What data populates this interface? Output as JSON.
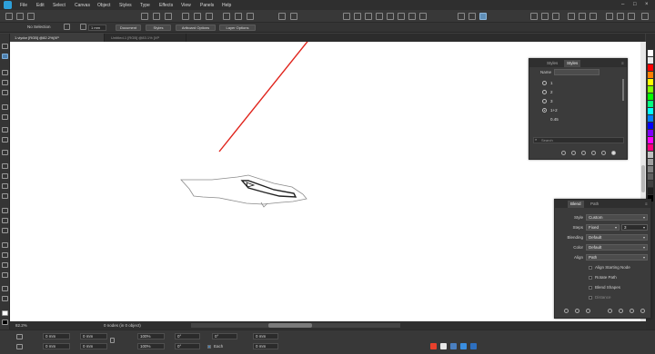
{
  "menu": {
    "items": [
      "File",
      "Edit",
      "Select",
      "Canvas",
      "Object",
      "Styles",
      "Type",
      "Effects",
      "View",
      "Panels",
      "Help"
    ]
  },
  "contextbar": {
    "selection": "No Selection",
    "stroke_value": "1 mm",
    "buttons": [
      "Document",
      "Styles",
      "Artboard Options",
      "Layer Options"
    ]
  },
  "doc_tabs": [
    {
      "label": "1.viydor [RGB] @82.2%[XP",
      "active": true
    },
    {
      "label": "Untitled-1 [RGB] @83.1% [XP",
      "active": false
    }
  ],
  "styles_panel": {
    "tabs": [
      "Styles",
      "Styles"
    ],
    "name_label": "Name",
    "items": [
      "1",
      "2",
      "3",
      "1+2",
      "0.45"
    ],
    "search_placeholder": "Search"
  },
  "blend_panel": {
    "tabs": [
      "Blend",
      "Path"
    ],
    "rows": [
      {
        "label": "Style",
        "value": "Custom"
      },
      {
        "label": "Steps",
        "value": "Fixed",
        "number": "3"
      },
      {
        "label": "Blending",
        "value": "Default"
      },
      {
        "label": "Color",
        "value": "Default"
      },
      {
        "label": "Align",
        "value": "Path"
      }
    ],
    "checks": [
      "Align Starting Node",
      "Rotate Path",
      "Blend Shapes",
      "Distance"
    ]
  },
  "statusbar": {
    "zoom": "82.2%",
    "nodes": "0 nodes (in 0 object)"
  },
  "transformbar": {
    "x": "0 mm",
    "y": "0 mm",
    "w": "0 mm",
    "h": "0 mm",
    "sx": "100%",
    "sy": "100%",
    "rot": "0°",
    "skew": "0°",
    "each_label": "Each",
    "ref1": "0°",
    "ref2": "0 mm",
    "ref3": "0 mm"
  },
  "colors": {
    "accent": "#2d9fd9",
    "guide_line": "#e0241c",
    "swatches": [
      "#ffffff",
      "#e8e8e8",
      "#ff0000",
      "#ff7f00",
      "#ffff00",
      "#7fff00",
      "#00ff00",
      "#00ff7f",
      "#00ffff",
      "#007fff",
      "#0000ff",
      "#7f00ff",
      "#ff00ff",
      "#ff007f",
      "#c0c0c0",
      "#a0a0a0",
      "#808080",
      "#606060",
      "#404040",
      "#202020",
      "#000000"
    ]
  }
}
